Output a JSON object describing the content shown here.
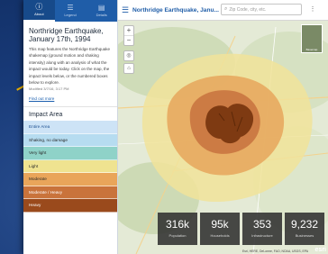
{
  "tabs": [
    {
      "label": "About",
      "icon": "info-icon"
    },
    {
      "label": "Legend",
      "icon": "legend-icon"
    },
    {
      "label": "Details",
      "icon": "details-icon"
    }
  ],
  "sidebar": {
    "title": "Northridge Earthquake, January 17th, 1994",
    "description": "This map features the Northridge Earthquake shakemap (ground motion and shaking intensity) along with an analysis of what the impact would be today. Click on the map, the impact levels below, or the numbered boxes below to explore.",
    "modified": "Modified 3/7/16, 3:17 PM",
    "find_more": "Find out more",
    "impact_header": "Impact Area",
    "legend": [
      {
        "label": "Entire Area",
        "color": "#cde3f6"
      },
      {
        "label": "Shaking, no damage",
        "color": "#b6dcf0"
      },
      {
        "label": "Very light",
        "color": "#8fd2c8"
      },
      {
        "label": "Light",
        "color": "#efe390"
      },
      {
        "label": "Moderate",
        "color": "#e9a55a"
      },
      {
        "label": "Moderate / Heavy",
        "color": "#c9733b"
      },
      {
        "label": "Heavy",
        "color": "#9a4a1c"
      }
    ]
  },
  "map": {
    "title": "Northridge Earthquake, Janu...",
    "search_placeholder": "Zip Code, city, etc.",
    "zoom_in": "+",
    "zoom_out": "−",
    "home_icon": "home-icon",
    "locate_icon": "locate-icon",
    "basemap_label": "Basemap",
    "attribution": "Esri, HERE, DeLorme, FAO, NOAA, USGS, EPA",
    "logo": "esri",
    "stats": [
      {
        "value": "316k",
        "label": "Population"
      },
      {
        "value": "95k",
        "label": "Households"
      },
      {
        "value": "353",
        "label": "Infrastructure"
      },
      {
        "value": "9,232",
        "label": "Businesses"
      }
    ]
  },
  "colors": {
    "header_blue": "#1f5da8",
    "accent": "#f0b400"
  }
}
